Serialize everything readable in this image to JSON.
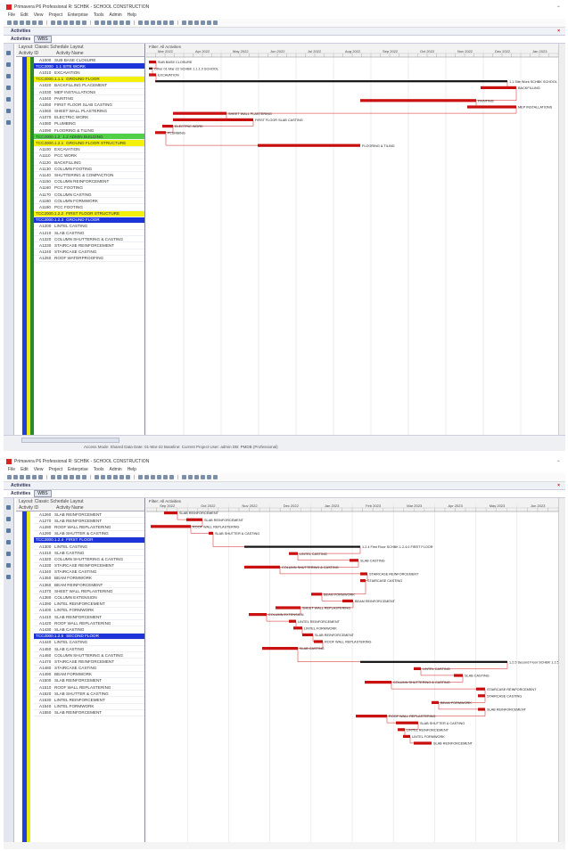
{
  "window1": {
    "title": "Primavera P6 Professional R: SCHBK - SCHOOL CONSTRUCTION",
    "menu": [
      "File",
      "Edit",
      "View",
      "Project",
      "Enterprise",
      "Tools",
      "Admin",
      "Help"
    ],
    "panel_title": "Activities",
    "tab_label": "Activities",
    "tab_active": "WBS",
    "grid_header_top": "Layout: Classic Schedule Layout",
    "col_id": "Activity ID",
    "col_name": "Activity Name",
    "gantt_header_top": "Filter: All Activities",
    "months": [
      "Mar 2022",
      "Apr 2022",
      "May 2022",
      "Jun 2022",
      "Jul 2022",
      "Aug 2022",
      "Sep 2022",
      "Oct 2022",
      "Nov 2022",
      "Dec 2022",
      "Jan 2023"
    ],
    "status": "Access Mode: Shared   Data Date: 01-Mar-22   Baseline: Current Project   User: admin   DB: PMDB (Professional)",
    "rows": [
      {
        "id": "A1000",
        "name": "SUB BASE CLOSURE",
        "style": "plain"
      },
      {
        "id": "TCC2000",
        "name": "1.1 SITE WORK",
        "style": "wbs-blue"
      },
      {
        "id": "A1010",
        "name": "EXCAVATION",
        "style": "plain"
      },
      {
        "id": "TCC2000.1.1.1",
        "name": "GROUND FLOOR",
        "style": "wbs-yellow"
      },
      {
        "id": "A1020",
        "name": "BACKFILLING PLACEMENT",
        "style": "plain"
      },
      {
        "id": "A1030",
        "name": "MEP INSTALLATIONS",
        "style": "plain"
      },
      {
        "id": "A1040",
        "name": "PAINTING",
        "style": "plain"
      },
      {
        "id": "A1050",
        "name": "FIRST FLOOR SLAB CASTING",
        "style": "plain"
      },
      {
        "id": "A1060",
        "name": "SHEET WALL PLASTERING",
        "style": "plain"
      },
      {
        "id": "A1070",
        "name": "ELECTRIC WORK",
        "style": "plain"
      },
      {
        "id": "A1080",
        "name": "PLUMBING",
        "style": "plain"
      },
      {
        "id": "A1090",
        "name": "FLOORING & TILING",
        "style": "plain"
      },
      {
        "id": "TCC2000.1.2",
        "name": "1.2 ADMIN BUILDING",
        "style": "wbs-green"
      },
      {
        "id": "TCC2000.1.2.1",
        "name": "GROUND FLOOR STRUCTURE",
        "style": "wbs-yellow"
      },
      {
        "id": "A1100",
        "name": "EXCAVATION",
        "style": "plain"
      },
      {
        "id": "A1110",
        "name": "PCC WORK",
        "style": "plain"
      },
      {
        "id": "A1120",
        "name": "BACKFILLING",
        "style": "plain"
      },
      {
        "id": "A1130",
        "name": "COLUMN FOOTING",
        "style": "plain"
      },
      {
        "id": "A1140",
        "name": "SHUTTERING & COMPACTION",
        "style": "plain"
      },
      {
        "id": "A1150",
        "name": "COLUMN REINFORCEMENT",
        "style": "plain"
      },
      {
        "id": "A1160",
        "name": "PCC FOOTING",
        "style": "plain"
      },
      {
        "id": "A1170",
        "name": "COLUMN CASTING",
        "style": "plain"
      },
      {
        "id": "A1180",
        "name": "COLUMN FORMWORK",
        "style": "plain"
      },
      {
        "id": "A1190",
        "name": "PCC FOOTING",
        "style": "plain"
      },
      {
        "id": "TCC2000.1.2.2",
        "name": "FIRST FLOOR STRUCTURE",
        "style": "wbs-yellow"
      },
      {
        "id": "TCC2000.1.2.3",
        "name": "GROUND FLOOR",
        "style": "wbs-blue"
      },
      {
        "id": "A1200",
        "name": "LINTEL CASTING",
        "style": "plain"
      },
      {
        "id": "A1210",
        "name": "SLAB CASTING",
        "style": "plain"
      },
      {
        "id": "A1220",
        "name": "COLUMN SHUTTERING & CASTING",
        "style": "plain"
      },
      {
        "id": "A1230",
        "name": "STAIRCASE REINFORCEMENT",
        "style": "plain"
      },
      {
        "id": "A1240",
        "name": "STAIRCASE CASTING",
        "style": "plain"
      },
      {
        "id": "A1250",
        "name": "ROOF WATERPROOFING",
        "style": "plain"
      }
    ],
    "gantt_labels": [
      "Other 01-Mar-22 SCHBK 1.1.1.0 SCHOOL",
      "SUB BASE CLOSURE",
      "1.1 Site Work SCHBK SCHOOL",
      "EXCAVATION",
      "BACKFILLING",
      "PAINTING",
      "MEP INSTALLATIONS",
      "SHEET WALL PLASTERING",
      "FIRST FLOOR SLAB CASTING",
      "ELECTRIC WORK",
      "PLUMBING",
      "FLOORING & TILING"
    ]
  },
  "window2": {
    "title": "Primavera P6 Professional R: SCHBK - SCHOOL CONSTRUCTION",
    "menu": [
      "File",
      "Edit",
      "View",
      "Project",
      "Enterprise",
      "Tools",
      "Admin",
      "Help"
    ],
    "panel_title": "Activities",
    "tab_label": "Activities",
    "tab_active": "WBS",
    "grid_header_top": "Layout: Classic Schedule Layout",
    "col_id": "Activity ID",
    "col_name": "Activity Name",
    "gantt_header_top": "Filter: All Activities",
    "months": [
      "Sep 2022",
      "Oct 2022",
      "Nov 2022",
      "Dec 2022",
      "Jan 2023",
      "Feb 2023",
      "Mar 2023",
      "Apr 2023",
      "May 2023",
      "Jun 2023"
    ],
    "rows": [
      {
        "id": "A1260",
        "name": "SLAB REINFORCEMENT",
        "style": "plain"
      },
      {
        "id": "A1270",
        "name": "SLAB REINFORCEMENT",
        "style": "plain"
      },
      {
        "id": "A1280",
        "name": "ROOF WALL REPLASTERING",
        "style": "plain"
      },
      {
        "id": "A1290",
        "name": "SLAB SHUTTER & CASTING",
        "style": "plain"
      },
      {
        "id": "TCC2000.1.2.4",
        "name": "FIRST FLOOR",
        "style": "wbs-blue"
      },
      {
        "id": "A1300",
        "name": "LINTEL CASTING",
        "style": "plain"
      },
      {
        "id": "A1310",
        "name": "SLAB CASTING",
        "style": "plain"
      },
      {
        "id": "A1320",
        "name": "COLUMN SHUTTERING & CASTING",
        "style": "plain"
      },
      {
        "id": "A1330",
        "name": "STAIRCASE REINFORCEMENT",
        "style": "plain"
      },
      {
        "id": "A1340",
        "name": "STAIRCASE CASTING",
        "style": "plain"
      },
      {
        "id": "A1350",
        "name": "BEAM FORMWORK",
        "style": "plain"
      },
      {
        "id": "A1360",
        "name": "BEAM REINFORCEMENT",
        "style": "plain"
      },
      {
        "id": "A1370",
        "name": "SHEET WALL REPLASTERING",
        "style": "plain"
      },
      {
        "id": "A1380",
        "name": "COLUMN EXTENSION",
        "style": "plain"
      },
      {
        "id": "A1390",
        "name": "LINTEL REINFORCEMENT",
        "style": "plain"
      },
      {
        "id": "A1400",
        "name": "LINTEL FORMWORK",
        "style": "plain"
      },
      {
        "id": "A1410",
        "name": "SLAB REINFORCEMENT",
        "style": "plain"
      },
      {
        "id": "A1420",
        "name": "ROOF WALL REPLASTERING",
        "style": "plain"
      },
      {
        "id": "A1430",
        "name": "SLAB CASTING",
        "style": "plain"
      },
      {
        "id": "TCC2000.1.2.5",
        "name": "SECOND FLOOR",
        "style": "wbs-blue"
      },
      {
        "id": "A1440",
        "name": "LINTEL CASTING",
        "style": "plain"
      },
      {
        "id": "A1450",
        "name": "SLAB CASTING",
        "style": "plain"
      },
      {
        "id": "A1460",
        "name": "COLUMN SHUTTERING & CASTING",
        "style": "plain"
      },
      {
        "id": "A1470",
        "name": "STAIRCASE REINFORCEMENT",
        "style": "plain"
      },
      {
        "id": "A1480",
        "name": "STAIRCASE CASTING",
        "style": "plain"
      },
      {
        "id": "A1490",
        "name": "BEAM FORMWORK",
        "style": "plain"
      },
      {
        "id": "A1500",
        "name": "SLAB REINFORCEMENT",
        "style": "plain"
      },
      {
        "id": "A1510",
        "name": "ROOF WALL REPLASTERING",
        "style": "plain"
      },
      {
        "id": "A1520",
        "name": "SLAB SHUTTER & CASTING",
        "style": "plain"
      },
      {
        "id": "A1530",
        "name": "LINTEL REINFORCEMENT",
        "style": "plain"
      },
      {
        "id": "A1540",
        "name": "LINTEL FORMWORK",
        "style": "plain"
      },
      {
        "id": "A1550",
        "name": "SLAB REINFORCEMENT",
        "style": "plain"
      }
    ],
    "gantt_labels": [
      "SLAB REINFORCEMENT",
      "SLAB REINFORCEMENT",
      "ROOF WALL REPLASTERING",
      "SLAB SHUTTER & CASTING",
      "1.2.4 First Floor SCHBK 1.2.4.0 FIRST FLOOR",
      "LINTEL CASTING",
      "SLAB CASTING",
      "COLUMN SHUTTERING & CASTING",
      "STAIRCASE REINFORCEMENT",
      "STAIRCASE CASTING",
      "BEAM FORMWORK",
      "BEAM REINFORCEMENT",
      "SHEET WALL REPLASTERING",
      "COLUMN EXTENSION",
      "LINTEL REINFORCEMENT",
      "LINTEL FORMWORK",
      "SLAB REINFORCEMENT",
      "ROOF WALL REPLASTERING",
      "SLAB CASTING",
      "1.2.5 Second Floor SCHBK 1.2.5.0 SECOND FLOOR",
      "LINTEL CASTING",
      "SLAB CASTING",
      "COLUMN SHUTTERING & CASTING",
      "STAIRCASE REINFORCEMENT",
      "STAIRCASE CASTING",
      "BEAM FORMWORK",
      "SLAB REINFORCEMENT",
      "ROOF WALL REPLASTERING",
      "SLAB SHUTTER & CASTING",
      "LINTEL REINFORCEMENT",
      "LINTEL FORMWORK",
      "SLAB REINFORCEMENT"
    ]
  },
  "colors": {
    "bar": "#c80d0d",
    "summary": "#111111",
    "wbs_blue": "#1d35d8",
    "wbs_yellow": "#f3f00c",
    "wbs_green": "#4fd046",
    "link": "#d21d1d"
  },
  "icons": [
    "app-icon",
    "close-icon",
    "minimize-icon",
    "toolbar-icon"
  ]
}
